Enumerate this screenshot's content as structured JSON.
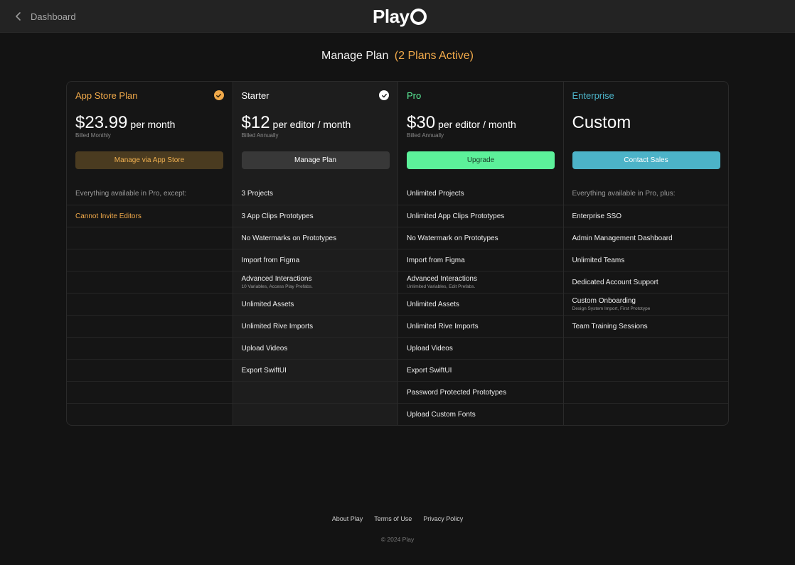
{
  "header": {
    "back_label": "Dashboard",
    "logo_text": "Play"
  },
  "title": {
    "main": "Manage Plan",
    "accent": "(2 Plans Active)"
  },
  "colors": {
    "app_store_accent": "#f0a94a",
    "pro_accent": "#5cf19a",
    "enterprise_accent": "#4cb3c8"
  },
  "plans": [
    {
      "name": "App Store Plan",
      "active_icon": "check-circle-icon",
      "amount": "$23.99",
      "per": "per month",
      "billed": "Billed Monthly",
      "button": "Manage via App Store",
      "features": [
        {
          "label": "Everything available in Pro, except:",
          "sub": ""
        },
        {
          "label": "Cannot Invite Editors",
          "sub": ""
        }
      ]
    },
    {
      "name": "Starter",
      "active_icon": "check-circle-icon",
      "amount": "$12",
      "per": "per editor / month",
      "billed": "Billed Annually",
      "button": "Manage Plan",
      "features": [
        {
          "label": "3 Projects",
          "sub": ""
        },
        {
          "label": "3 App Clips Prototypes",
          "sub": ""
        },
        {
          "label": "No Watermarks on Prototypes",
          "sub": ""
        },
        {
          "label": "Import from Figma",
          "sub": ""
        },
        {
          "label": "Advanced Interactions",
          "sub": "10 Variables, Access Play Prefabs."
        },
        {
          "label": "Unlimited Assets",
          "sub": ""
        },
        {
          "label": "Unlimited Rive Imports",
          "sub": ""
        },
        {
          "label": "Upload Videos",
          "sub": ""
        },
        {
          "label": "Export SwiftUI",
          "sub": ""
        }
      ]
    },
    {
      "name": "Pro",
      "amount": "$30",
      "per": "per editor / month",
      "billed": "Billed Annually",
      "button": "Upgrade",
      "features": [
        {
          "label": "Unlimited Projects",
          "sub": ""
        },
        {
          "label": "Unlimited App Clips Prototypes",
          "sub": ""
        },
        {
          "label": "No Watermark on Prototypes",
          "sub": ""
        },
        {
          "label": "Import from Figma",
          "sub": ""
        },
        {
          "label": "Advanced Interactions",
          "sub": "Unlimited Variables, Edit Prefabs."
        },
        {
          "label": "Unlimited Assets",
          "sub": ""
        },
        {
          "label": "Unlimited Rive Imports",
          "sub": ""
        },
        {
          "label": "Upload Videos",
          "sub": ""
        },
        {
          "label": "Export SwiftUI",
          "sub": ""
        },
        {
          "label": "Password Protected Prototypes",
          "sub": ""
        },
        {
          "label": "Upload Custom Fonts",
          "sub": ""
        }
      ]
    },
    {
      "name": "Enterprise",
      "custom_price": "Custom",
      "button": "Contact Sales",
      "features": [
        {
          "label": "Everything available in Pro, plus:",
          "sub": ""
        },
        {
          "label": "Enterprise SSO",
          "sub": ""
        },
        {
          "label": "Admin Management Dashboard",
          "sub": ""
        },
        {
          "label": "Unlimited Teams",
          "sub": ""
        },
        {
          "label": "Dedicated Account Support",
          "sub": ""
        },
        {
          "label": "Custom Onboarding",
          "sub": "Design System Import, First Prototype"
        },
        {
          "label": "Team Training Sessions",
          "sub": ""
        }
      ]
    }
  ],
  "footer": {
    "links": [
      "About Play",
      "Terms of Use",
      "Privacy Policy"
    ],
    "copyright": "© 2024 Play"
  }
}
